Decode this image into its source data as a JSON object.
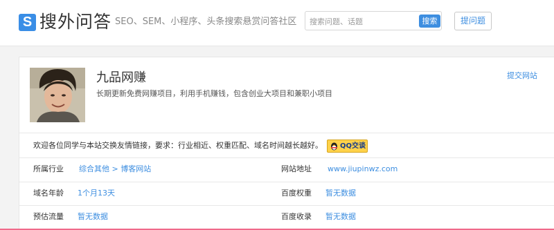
{
  "header": {
    "logo_letter": "S",
    "site_title": "搜外问答",
    "slogan": "SEO、SEM、小程序、头条搜索悬赏问答社区",
    "search": {
      "placeholder": "搜索问题、话题",
      "button": "搜索"
    },
    "ask_button": "提问题"
  },
  "profile": {
    "name": "九品网赚",
    "description": "长期更新免费网赚项目，利用手机赚钱，包含创业大项目和兼职小项目",
    "submit_link": "提交网站"
  },
  "notice": {
    "text": "欢迎各位同学与本站交换友情链接，要求：行业相近、权重匹配、域名时间越长越好。",
    "qq_button": "QQ交谈"
  },
  "info": {
    "industry": {
      "label": "所属行业",
      "category": "综合其他",
      "separator": ">",
      "subcategory": "博客网站"
    },
    "url": {
      "label": "网站地址",
      "value": "www.jiupinwz.com"
    },
    "domain_age": {
      "label": "域名年龄",
      "value": "1个月13天"
    },
    "baidu_weight": {
      "label": "百度权重",
      "value": "暂无数据"
    },
    "traffic": {
      "label": "预估流量",
      "value": "暂无数据"
    },
    "baidu_index": {
      "label": "百度收录",
      "value": "暂无数据"
    }
  },
  "colors": {
    "accent": "#3d8ee0",
    "qq_yellow": "#ffd24a",
    "bottom_bar": "#f06a8a"
  }
}
